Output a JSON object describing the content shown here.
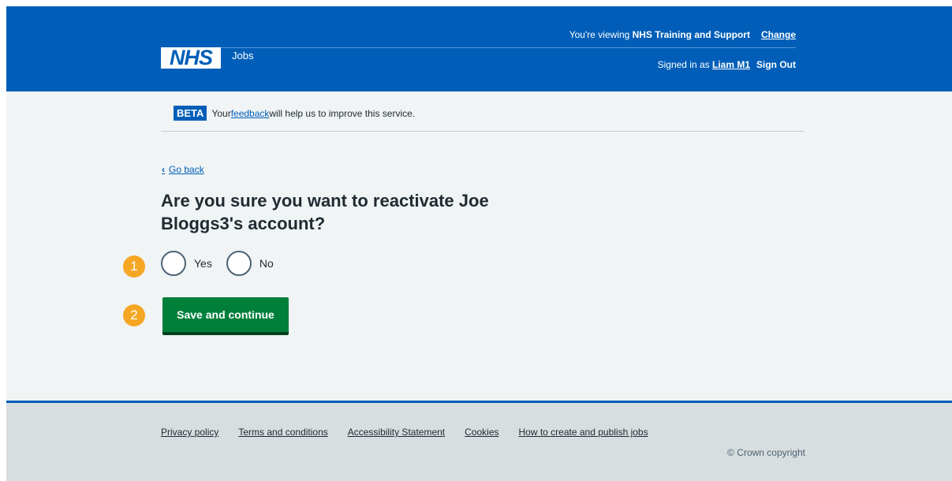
{
  "header": {
    "viewing_prefix": "You're viewing ",
    "organisation": "NHS Training and Support",
    "change_link": "Change",
    "logo_text": "NHS",
    "service_name": "Jobs",
    "signed_in_prefix": "Signed in as ",
    "user_name": "Liam M1",
    "sign_out": "Sign Out"
  },
  "beta": {
    "tag": "BETA",
    "text_before": "Your ",
    "link": "feedback",
    "text_after": " will help us to improve this service."
  },
  "nav": {
    "go_back": "Go back"
  },
  "main": {
    "title": "Are you sure you want to reactivate Joe Bloggs3's account?",
    "options": [
      "Yes",
      "No"
    ],
    "submit_label": "Save and continue",
    "step_badges": [
      "1",
      "2"
    ]
  },
  "footer": {
    "links": [
      "Privacy policy",
      "Terms and conditions",
      "Accessibility Statement",
      "Cookies",
      "How to create and publish jobs"
    ],
    "copyright": "© Crown copyright"
  },
  "colors": {
    "nhs_blue": "#005eb8",
    "button_green": "#007f3b",
    "badge_orange": "#f5a623",
    "page_bg": "#f0f4f5",
    "footer_bg": "#d8dde0"
  }
}
